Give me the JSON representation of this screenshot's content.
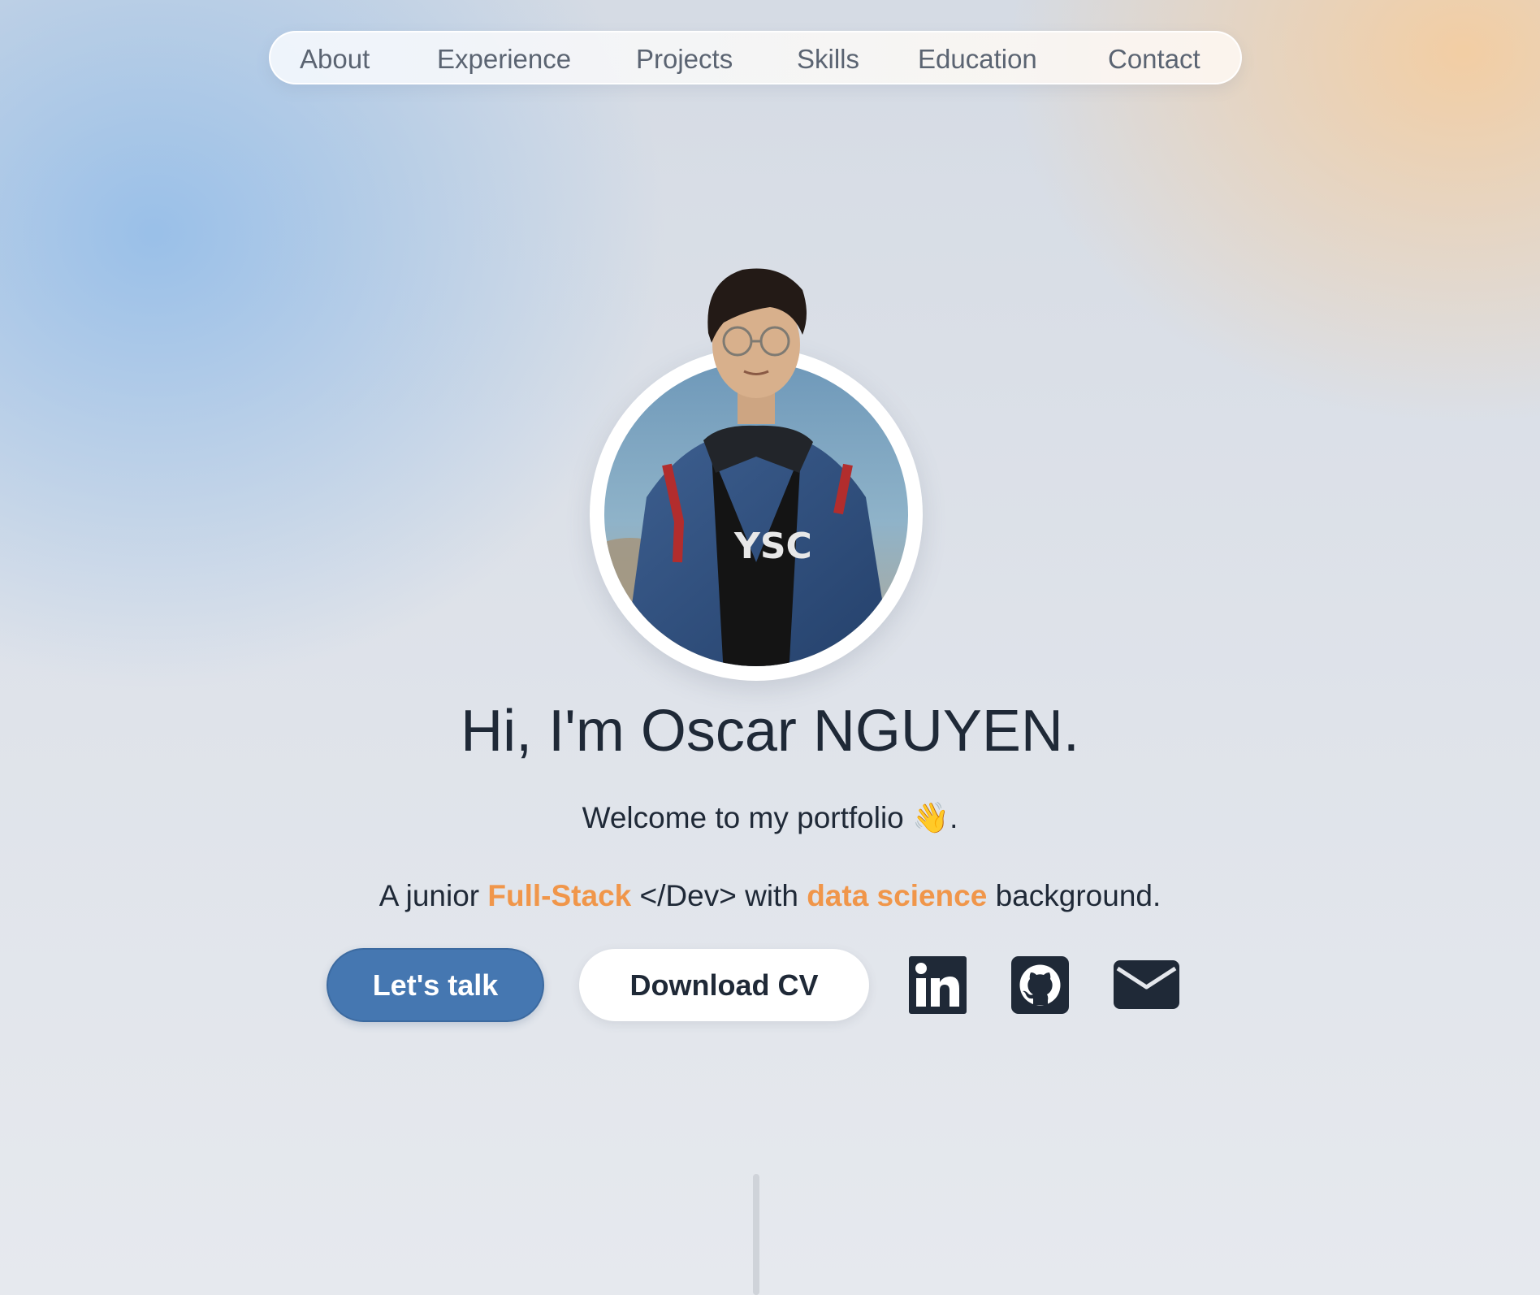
{
  "nav": {
    "items": [
      {
        "label": "About"
      },
      {
        "label": "Experience"
      },
      {
        "label": "Projects"
      },
      {
        "label": "Skills"
      },
      {
        "label": "Education"
      },
      {
        "label": "Contact"
      }
    ]
  },
  "hero": {
    "title": "Hi, I'm Oscar NGUYEN.",
    "welcome_text": "Welcome to my portfolio",
    "welcome_emoji": "👋",
    "welcome_end": ".",
    "tagline": {
      "part1": "A junior ",
      "highlight1": "Full-Stack",
      "part2": " </Dev> with ",
      "highlight2": "data science",
      "part3": " background."
    }
  },
  "actions": {
    "talk_label": "Let's talk",
    "cv_label": "Download CV"
  },
  "social": {
    "icons": [
      "linkedin-icon",
      "github-icon",
      "mail-icon"
    ]
  },
  "colors": {
    "accent": "#f0964a",
    "primary_button": "#4577b1",
    "text": "#1f2937",
    "icon": "#1f2937"
  }
}
